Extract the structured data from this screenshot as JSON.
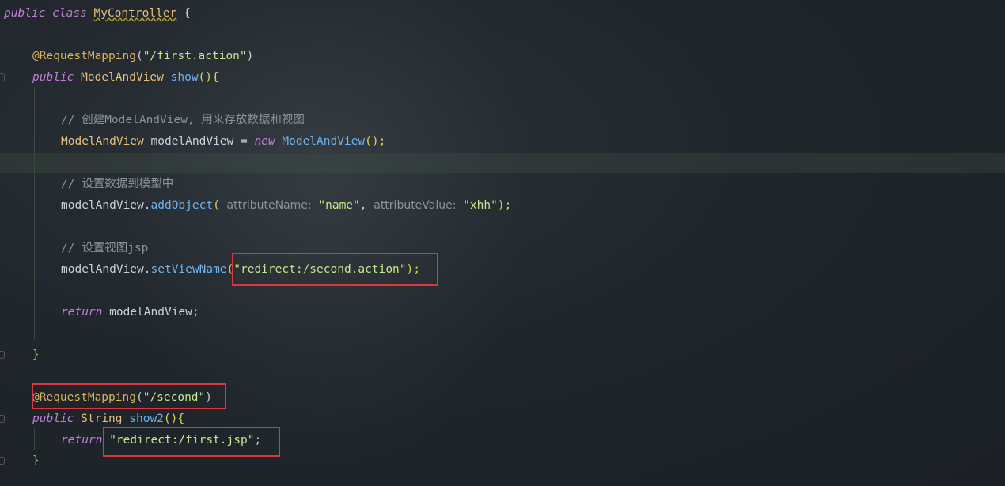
{
  "code": {
    "l1": {
      "kw_public": "public",
      "kw_class": "class",
      "class_name": "MyController",
      "brace": "{"
    },
    "l2": {
      "annotation": "@RequestMapping",
      "open": "(",
      "str": "\"/first.action\"",
      "close": ")"
    },
    "l3": {
      "kw_public": "public",
      "type": "ModelAndView",
      "method": "show",
      "parens": "()",
      "brace": "{"
    },
    "l4": {
      "comment": "// 创建ModelAndView, 用来存放数据和视图"
    },
    "l5": {
      "type": "ModelAndView",
      "var": "modelAndView =",
      "kw_new": "new",
      "ctor": "ModelAndView",
      "tail": "();"
    },
    "l6": {
      "comment": "// 设置数据到模型中"
    },
    "l7": {
      "obj": "modelAndView.",
      "method": "addObject",
      "open": "(",
      "hint1": "attributeName:",
      "str1": "\"name\"",
      "comma": ",",
      "hint2": "attributeValue:",
      "str2": "\"xhh\"",
      "close": ");"
    },
    "l8": {
      "comment": "// 设置视图jsp"
    },
    "l9": {
      "obj": "modelAndView.",
      "method": "setViewName",
      "open": "(",
      "str": "\"redirect:/second.action\"",
      "close": ");"
    },
    "l10": {
      "kw_return": "return",
      "var": "modelAndView;"
    },
    "l11": {
      "brace": "}"
    },
    "l12": {
      "annotation": "@RequestMapping",
      "open": "(",
      "str": "\"/second\"",
      "close": ")"
    },
    "l13": {
      "kw_public": "public",
      "type": "String",
      "method": "show2",
      "parens": "()",
      "brace": "{"
    },
    "l14": {
      "kw_return": "return",
      "str": "\"redirect:/first.jsp\"",
      "semi": ";"
    },
    "l15": {
      "brace": "}"
    }
  },
  "colors": {
    "background": "#20262b",
    "keyword": "#c27edb",
    "class": "#e5c07b",
    "annotation": "#d9b25b",
    "string": "#c3e88d",
    "method": "#6fb3ec",
    "comment": "#8b939b",
    "highlight_box": "#e0363b"
  }
}
